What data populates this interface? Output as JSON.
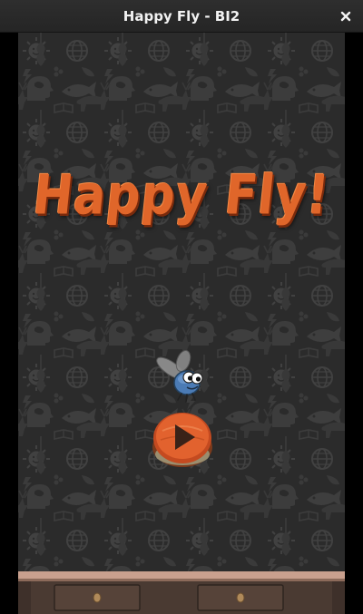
{
  "window": {
    "title": "Happy Fly - BI2",
    "close_icon": "close-icon"
  },
  "game": {
    "logo_text": "Happy Fly!",
    "play_icon": "play-icon",
    "mascot_icon": "fly-icon",
    "colors": {
      "logo": "#e0662a",
      "wallpaper": "#2f2f2f",
      "pattern": "#454545",
      "shelf": "#4a3a32",
      "play_button": "#d9562a"
    }
  }
}
